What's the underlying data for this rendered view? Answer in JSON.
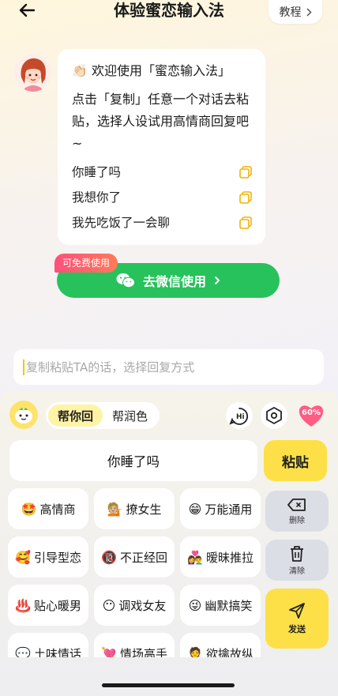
{
  "header": {
    "title": "体验蜜恋输入法",
    "tutorial_label": "教程"
  },
  "chat": {
    "welcome": "👏🏻 欢迎使用「蜜恋输入法」",
    "description": "点击「复制」任意一个对话去粘贴，选择人设试用高情商回复吧~",
    "phrases": [
      "你睡了吗",
      "我想你了",
      "我先吃饭了一会聊"
    ]
  },
  "promo": {
    "free_tag": "可免费使用",
    "wechat_button": "去微信使用"
  },
  "input": {
    "placeholder": "复制粘贴TA的话，选择回复方式"
  },
  "keyboard": {
    "tabs": [
      "帮你回",
      "帮润色"
    ],
    "active_tab": "帮你回",
    "heart_badge": "60%",
    "selected_phrase": "你睡了吗",
    "paste_label": "粘贴",
    "delete_label": "删除",
    "clear_label": "清除",
    "send_label": "发送",
    "styles": [
      {
        "emoji": "🤩",
        "label": "高情商"
      },
      {
        "emoji": "💁🏼",
        "label": "撩女生"
      },
      {
        "emoji": "😁",
        "label": "万能通用"
      },
      {
        "emoji": "🥰",
        "label": "引导型恋"
      },
      {
        "emoji": "🔞",
        "label": "不正经回"
      },
      {
        "emoji": "👩‍❤️‍👨",
        "label": "暧昧推拉"
      },
      {
        "emoji": "♨️",
        "label": "贴心暖男"
      },
      {
        "emoji": "😶",
        "label": "调戏女友"
      },
      {
        "emoji": "😜",
        "label": "幽默搞笑"
      },
      {
        "emoji": "💬",
        "label": "土味情话"
      },
      {
        "emoji": "💘",
        "label": "情场高手"
      },
      {
        "emoji": "🤵",
        "label": "欲擒故纵"
      }
    ]
  },
  "colors": {
    "accent_yellow": "#fde047",
    "wechat_green": "#27c25c",
    "tag_pink": "#ff4f7b"
  }
}
